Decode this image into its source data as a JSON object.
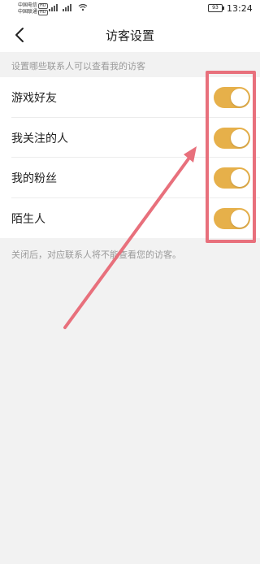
{
  "status_bar": {
    "carrier_1": "中国电信",
    "carrier_2": "中国联通",
    "hd_badge": "HD",
    "battery": "93",
    "time": "13:24"
  },
  "header": {
    "title": "访客设置",
    "back_icon": "chevron-left-icon"
  },
  "section_hint": "设置哪些联系人可以查看我的访客",
  "settings": [
    {
      "label": "游戏好友",
      "enabled": true
    },
    {
      "label": "我关注的人",
      "enabled": true
    },
    {
      "label": "我的粉丝",
      "enabled": true
    },
    {
      "label": "陌生人",
      "enabled": true
    }
  ],
  "footer_note": "关闭后，对应联系人将不能查看您的访客。",
  "colors": {
    "toggle_on": "#e6b04a",
    "annotation": "#e8707c"
  }
}
